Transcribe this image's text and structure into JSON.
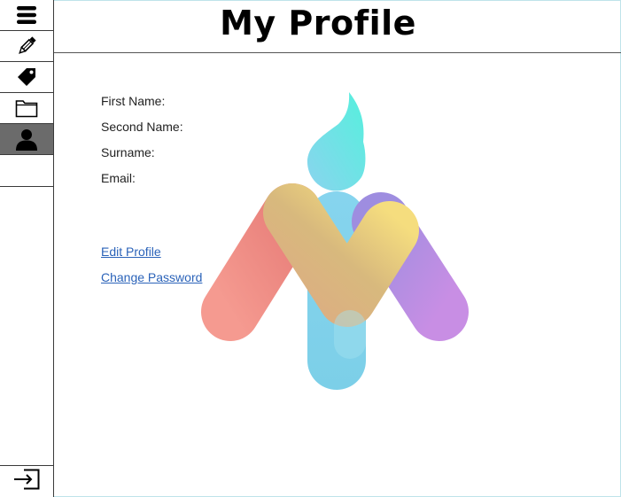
{
  "header": {
    "title": "My Profile"
  },
  "sidebar": {
    "items": [
      {
        "icon": "menu-icon"
      },
      {
        "icon": "pencil-icon"
      },
      {
        "icon": "tag-icon"
      },
      {
        "icon": "folder-icon"
      },
      {
        "icon": "user-icon",
        "active": true
      }
    ],
    "logout_icon": "logout-icon"
  },
  "profile": {
    "first_name_label": "First Name:",
    "second_name_label": "Second Name:",
    "surname_label": "Surname:",
    "email_label": "Email:"
  },
  "links": {
    "edit_profile": "Edit Profile",
    "change_password": "Change Password"
  },
  "colors": {
    "active_sidebar": "#6b6b6b",
    "link": "#2b63b9",
    "logo_cyan": "#5ad4e6",
    "logo_red": "#ec7f74",
    "logo_yellow": "#f0d678",
    "logo_purple": "#b58ee6"
  }
}
